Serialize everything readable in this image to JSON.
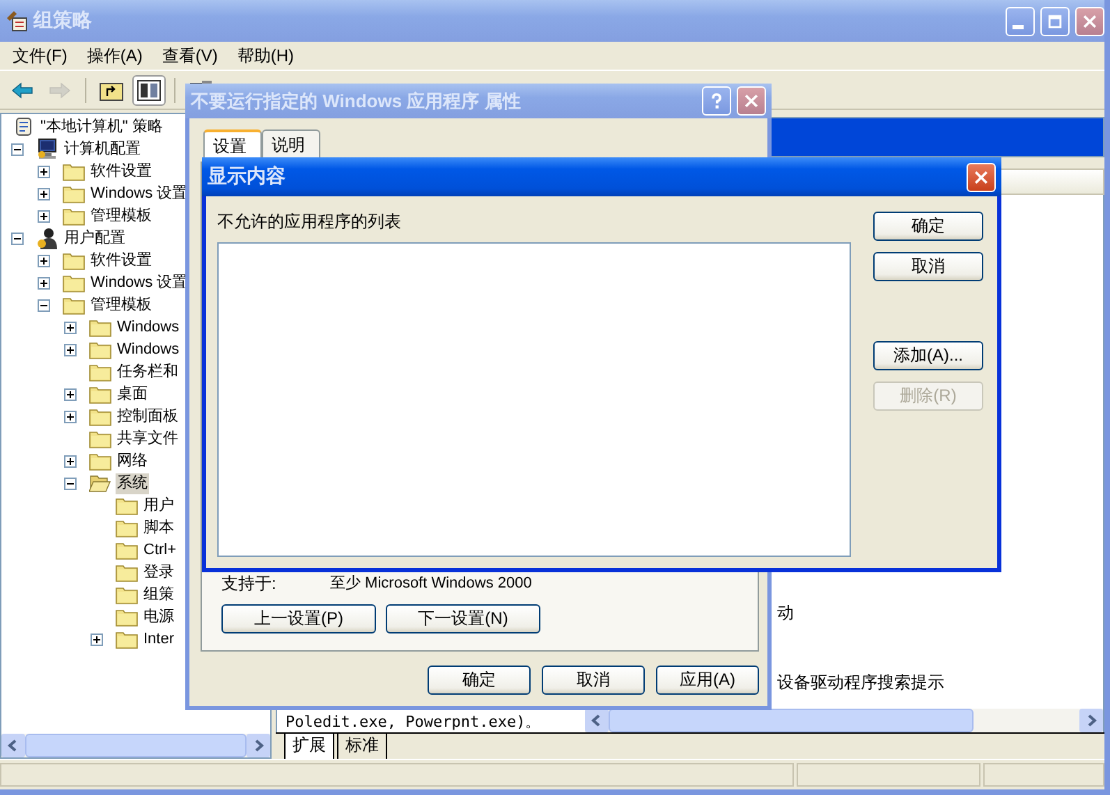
{
  "window": {
    "title": "组策略",
    "active": false
  },
  "menu": [
    {
      "label": "文件(F)"
    },
    {
      "label": "操作(A)"
    },
    {
      "label": "查看(V)"
    },
    {
      "label": "帮助(H)"
    }
  ],
  "toolbar": [
    {
      "kind": "back",
      "disabled": false,
      "pressed": false
    },
    {
      "kind": "forward",
      "disabled": true,
      "pressed": false
    },
    {
      "kind": "up",
      "disabled": false,
      "pressed": false
    },
    {
      "kind": "tree",
      "disabled": false,
      "pressed": true
    },
    {
      "kind": "properties",
      "disabled": false,
      "pressed": false
    }
  ],
  "tree": {
    "items": [
      {
        "label": "\"本地计算机\" 策略",
        "kind": "policy",
        "selected": false,
        "children": [
          {
            "label": "计算机配置",
            "kind": "computer",
            "expanded": true,
            "selected": false,
            "children": [
              {
                "label": "软件设置",
                "kind": "folder",
                "expanded": false,
                "selected": false
              },
              {
                "label": "Windows 设置",
                "kind": "folder",
                "expanded": false,
                "selected": false
              },
              {
                "label": "管理模板",
                "kind": "folder",
                "expanded": false,
                "selected": false
              }
            ]
          },
          {
            "label": "用户配置",
            "kind": "user",
            "expanded": true,
            "selected": false,
            "children": [
              {
                "label": "软件设置",
                "kind": "folder",
                "expanded": false,
                "selected": false
              },
              {
                "label": "Windows 设置",
                "kind": "folder",
                "expanded": false,
                "selected": false
              },
              {
                "label": "管理模板",
                "kind": "folder",
                "expanded": true,
                "selected": false,
                "children": [
                  {
                    "label": "Windows",
                    "kind": "folder",
                    "expanded": false,
                    "selected": false
                  },
                  {
                    "label": "Windows",
                    "kind": "folder",
                    "expanded": false,
                    "selected": false
                  },
                  {
                    "label": "任务栏和",
                    "kind": "folder",
                    "selected": false
                  },
                  {
                    "label": "桌面",
                    "kind": "folder",
                    "expanded": false,
                    "selected": false
                  },
                  {
                    "label": "控制面板",
                    "kind": "folder",
                    "expanded": false,
                    "selected": false
                  },
                  {
                    "label": "共享文件",
                    "kind": "folder",
                    "selected": false
                  },
                  {
                    "label": "网络",
                    "kind": "folder",
                    "expanded": false,
                    "selected": false
                  },
                  {
                    "label": "系统",
                    "kind": "folder",
                    "expanded": true,
                    "selected": true,
                    "children": [
                      {
                        "label": "用户",
                        "kind": "folder",
                        "selected": false
                      },
                      {
                        "label": "脚本",
                        "kind": "folder",
                        "selected": false
                      },
                      {
                        "label": "Ctrl+",
                        "kind": "folder",
                        "selected": false
                      },
                      {
                        "label": "登录",
                        "kind": "folder",
                        "selected": false
                      },
                      {
                        "label": "组策",
                        "kind": "folder",
                        "selected": false
                      },
                      {
                        "label": "电源",
                        "kind": "folder",
                        "selected": false
                      },
                      {
                        "label": "Inter",
                        "kind": "folder",
                        "expanded": false,
                        "selected": false
                      }
                    ]
                  }
                ]
              }
            ]
          }
        ]
      }
    ]
  },
  "right_pane": {
    "description": "Poledit.exe, Powerpnt.exe)。",
    "rows": [
      {
        "text": "动"
      },
      {
        "text": "设备驱动程序搜索提示"
      }
    ],
    "view_tabs": [
      {
        "label": "扩展",
        "selected": true
      },
      {
        "label": "标准",
        "selected": false
      }
    ]
  },
  "properties_dialog": {
    "title": "不要运行指定的 Windows 应用程序 属性",
    "active": false,
    "tabs": [
      {
        "label": "设置",
        "selected": true
      },
      {
        "label": "说明",
        "selected": false
      }
    ],
    "supported_label": "支持于:",
    "supported_value": "至少 Microsoft Windows 2000",
    "nav_buttons": [
      {
        "label": "上一设置(P)"
      },
      {
        "label": "下一设置(N)"
      }
    ],
    "buttons": [
      {
        "label": "确定"
      },
      {
        "label": "取消"
      },
      {
        "label": "应用(A)"
      }
    ]
  },
  "show_dialog": {
    "title": "显示内容",
    "active": true,
    "list_label": "不允许的应用程序的列表",
    "buttons": [
      {
        "label": "确定",
        "disabled": false
      },
      {
        "label": "取消",
        "disabled": false
      }
    ],
    "list_buttons": [
      {
        "label": "添加(A)...",
        "disabled": false
      },
      {
        "label": "删除(R)",
        "disabled": true
      }
    ]
  }
}
